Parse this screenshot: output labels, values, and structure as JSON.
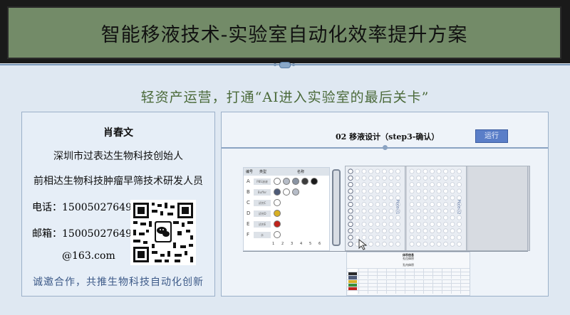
{
  "header": {
    "title": "智能移液技术-实验室自动化效率提升方案"
  },
  "subtitle": "轻资产运营，打通“AI进入实验室的最后关卡”",
  "contact": {
    "name": "肖春文",
    "line1": "深圳市过表达生物科技创始人",
    "line2": "前相达生物科技肿瘤早筛技术研发人员",
    "phone": "电话：15005027649",
    "mail": "邮箱：15005027649",
    "domain": "@163.com",
    "slogan": "诚邀合作，共推生物科技自动化创新"
  },
  "screen": {
    "step_title": "02 移液设计（step3-确认）",
    "run_label": "运行",
    "panel_head_code": "编号",
    "panel_head_type": "类型",
    "panel_head_name": "名称",
    "rows": [
      {
        "code": "A",
        "pill": "PBS溶液",
        "wells": [
          "#ffffff",
          "#b6bcc7",
          "#8a94a3",
          "#3c3c3c",
          "#1a1a1a"
        ]
      },
      {
        "code": "B",
        "pill": "Buffer",
        "wells": [
          "#4e5b78",
          "#ffffff",
          "#b6bcc7"
        ]
      },
      {
        "code": "C",
        "pill": "试剂C",
        "wells": [
          "#ffffff"
        ]
      },
      {
        "code": "D",
        "pill": "试剂D",
        "wells": [
          "#d8b024"
        ]
      },
      {
        "code": "E",
        "pill": "试剂E",
        "wells": [
          "#c0241c"
        ]
      },
      {
        "code": "F",
        "pill": "水",
        "wells": [
          "#ffffff"
        ]
      }
    ],
    "col_nums": [
      "1",
      "2",
      "3",
      "4",
      "5",
      "6"
    ],
    "plate1_label": "Plate-01",
    "plate2_label": "Plate-02",
    "table_title": "体积信息",
    "table_sub1": "孔位体积",
    "table_sub2": "孔内体积"
  }
}
